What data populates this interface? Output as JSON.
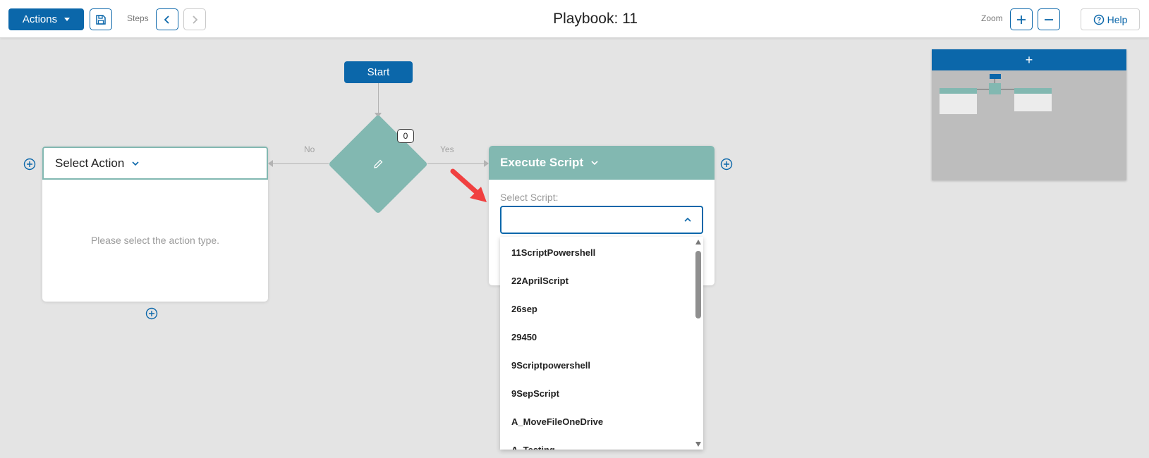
{
  "header": {
    "actions_label": "Actions",
    "steps_label": "Steps",
    "title": "Playbook: 11",
    "zoom_label": "Zoom",
    "help_label": "Help"
  },
  "flow": {
    "start_label": "Start",
    "decision_badge": "0",
    "no_label": "No",
    "yes_label": "Yes",
    "left_card": {
      "title": "Select Action",
      "placeholder": "Please select the action type."
    },
    "right_card": {
      "title": "Execute Script",
      "select_label": "Select Script:"
    }
  },
  "dropdown": {
    "options": [
      "11ScriptPowershell",
      "22AprilScript",
      "26sep",
      "29450",
      "9Scriptpowershell",
      "9SepScript",
      "A_MoveFileOneDrive",
      "A_Testing"
    ]
  },
  "minimap": {
    "header_label": "+"
  },
  "colors": {
    "primary": "#0b67aa",
    "teal": "#82b8b1",
    "canvas": "#e4e4e4",
    "annotation_arrow": "#f04040"
  }
}
